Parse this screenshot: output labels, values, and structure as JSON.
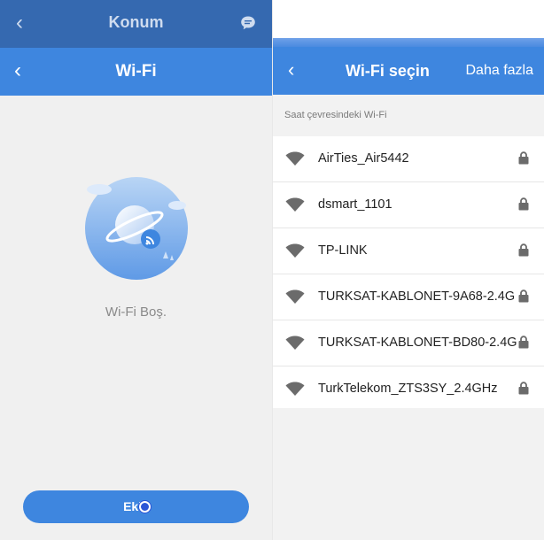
{
  "left": {
    "top_title": "Konum",
    "bar_title": "Wi-Fi",
    "empty_text": "Wi-Fi Boş.",
    "add_button": "Ekle"
  },
  "right": {
    "bar_title": "Wi-Fi seçin",
    "more_label": "Daha fazla",
    "section_label": "Saat çevresindeki Wi-Fi",
    "networks": [
      {
        "name": "AirTies_Air5442",
        "locked": true
      },
      {
        "name": "dsmart_1101",
        "locked": true
      },
      {
        "name": "TP-LINK",
        "locked": true
      },
      {
        "name": "TURKSAT-KABLONET-9A68-2.4G",
        "locked": true
      },
      {
        "name": "TURKSAT-KABLONET-BD80-2.4G",
        "locked": true
      },
      {
        "name": "TurkTelekom_ZTS3SY_2.4GHz",
        "locked": true
      }
    ]
  },
  "colors": {
    "primary": "#3e86df",
    "dark_header": "#3569b0",
    "background": "#f0f0f0"
  },
  "icons": [
    "back-arrow-icon",
    "chat-icon",
    "planet-wifi-illustration",
    "wifi-signal-icon",
    "lock-icon"
  ]
}
